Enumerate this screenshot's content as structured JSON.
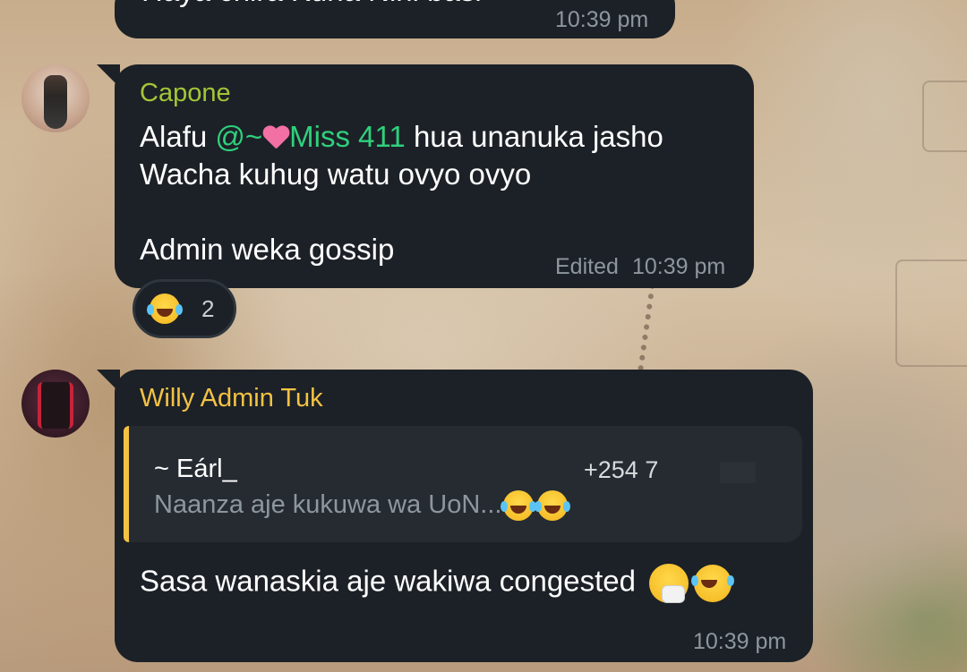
{
  "messages": [
    {
      "text": "Haya chira Kuna Nini basi",
      "time": "10:39 pm"
    },
    {
      "sender": "Capone",
      "sender_color": "#a5c536",
      "lines": {
        "l1_pre": "Alafu ",
        "mention_prefix": "@~",
        "mention_name": "Miss 411",
        "l1_post": " hua unanuka jasho",
        "l2": "Wacha kuhug watu ovyo ovyo",
        "l3": "Admin weka gossip"
      },
      "edited_label": "Edited",
      "time": "10:39 pm",
      "reaction": {
        "emoji": "laughing-with-tears",
        "count": "2"
      }
    },
    {
      "sender": "Willy Admin Tuk",
      "sender_color": "#f3c244",
      "reply": {
        "author": "~ Eárl_",
        "phone": "+254 7",
        "preview": "Naanza aje kukuwa wa UoN..."
      },
      "text": "Sasa wanaskia aje wakiwa congested",
      "time": "10:39 pm"
    }
  ],
  "colors": {
    "bubble": "#1c2127",
    "mention": "#2fd07c",
    "meta": "#8e969e"
  }
}
